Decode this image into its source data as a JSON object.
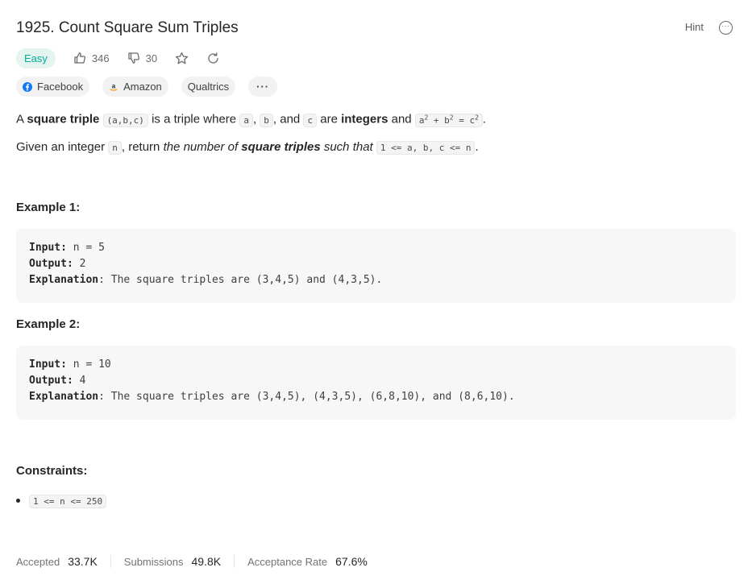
{
  "problem": {
    "title": "1925. Count Square Sum Triples",
    "hint_label": "Hint",
    "difficulty": "Easy",
    "likes": "346",
    "dislikes": "30"
  },
  "tags": [
    {
      "label": "Facebook"
    },
    {
      "label": "Amazon"
    },
    {
      "label": "Qualtrics"
    },
    {
      "label": "···"
    }
  ],
  "description": {
    "p1": {
      "t1": "A ",
      "b1": "square triple",
      "c1": "(a,b,c)",
      "t2": " is a triple where ",
      "c2": "a",
      "t3": ", ",
      "c3": "b",
      "t4": ", and ",
      "c4": "c",
      "t5": " are ",
      "b2": "integers",
      "t6": " and ",
      "eq_a": "a",
      "eq_b": " + b",
      "eq_c": " = c",
      "sup": "2",
      "t7": "."
    },
    "p2": {
      "t1": "Given an integer ",
      "c1": "n",
      "t2": ", return ",
      "i1": "the number of ",
      "bi": "square triples",
      "i2": " such that",
      "t3": " ",
      "c2": "1 <= a, b, c <= n",
      "t4": "."
    }
  },
  "examples": [
    {
      "heading": "Example 1:",
      "input_label": "Input:",
      "input": " n = 5",
      "output_label": "Output:",
      "output": " 2",
      "explanation_label": "Explanation",
      "explanation": ": The square triples are (3,4,5) and (4,3,5)."
    },
    {
      "heading": "Example 2:",
      "input_label": "Input:",
      "input": " n = 10",
      "output_label": "Output:",
      "output": " 4",
      "explanation_label": "Explanation",
      "explanation": ": The square triples are (3,4,5), (4,3,5), (6,8,10), and (8,6,10)."
    }
  ],
  "constraints": {
    "heading": "Constraints:",
    "items": [
      "1 <= n <= 250"
    ]
  },
  "stats": {
    "accepted_label": "Accepted",
    "accepted_value": "33.7K",
    "submissions_label": "Submissions",
    "submissions_value": "49.8K",
    "acceptance_label": "Acceptance Rate",
    "acceptance_value": "67.6%"
  },
  "colors": {
    "easy": "#00af9b",
    "easy_bg": "#e6f4ef",
    "facebook": "#1877f2",
    "amazon": "#ff9900"
  },
  "icons": [
    "thumbs-up-icon",
    "thumbs-down-icon",
    "star-icon",
    "refresh-icon",
    "more-icon",
    "facebook-logo-icon",
    "amazon-logo-icon"
  ]
}
